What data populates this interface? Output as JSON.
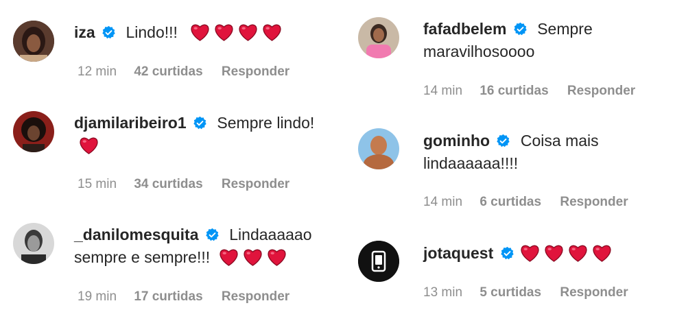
{
  "comments_left": [
    {
      "username": "iza",
      "text": "Lindo!!!",
      "hearts": 4,
      "time": "12 min",
      "likes": "42 curtidas",
      "reply": "Responder",
      "avatar_icon": "profile-photo-icon"
    },
    {
      "username": "djamilaribeiro1",
      "text": "Sempre lindo!",
      "hearts": 1,
      "time": "15 min",
      "likes": "34 curtidas",
      "reply": "Responder",
      "avatar_icon": "profile-photo-icon"
    },
    {
      "username": "_danilomesquita",
      "text_line1": "Lindaaaaao",
      "text_line2": "sempre e sempre!!!",
      "hearts": 3,
      "time": "19 min",
      "likes": "17 curtidas",
      "reply": "Responder",
      "avatar_icon": "profile-photo-icon"
    }
  ],
  "comments_right": [
    {
      "username": "fafadbelem",
      "text_line1": "Sempre",
      "text_line2": "maravilhosoooo",
      "time": "14 min",
      "likes": "16 curtidas",
      "reply": "Responder",
      "avatar_icon": "profile-photo-icon"
    },
    {
      "username": "gominho",
      "text_line1": "Coisa mais",
      "text_line2": "lindaaaaaa!!!!",
      "time": "14 min",
      "likes": "6 curtidas",
      "reply": "Responder",
      "avatar_icon": "profile-photo-icon"
    },
    {
      "username": "jotaquest",
      "text": "",
      "hearts": 4,
      "time": "13 min",
      "likes": "5 curtidas",
      "reply": "Responder",
      "avatar_icon": "phone-logo-icon"
    }
  ],
  "colors": {
    "verified_blue": "#0095f6",
    "heart_red": "#e0143c",
    "meta_gray": "#8e8e8e",
    "text": "#262626"
  }
}
